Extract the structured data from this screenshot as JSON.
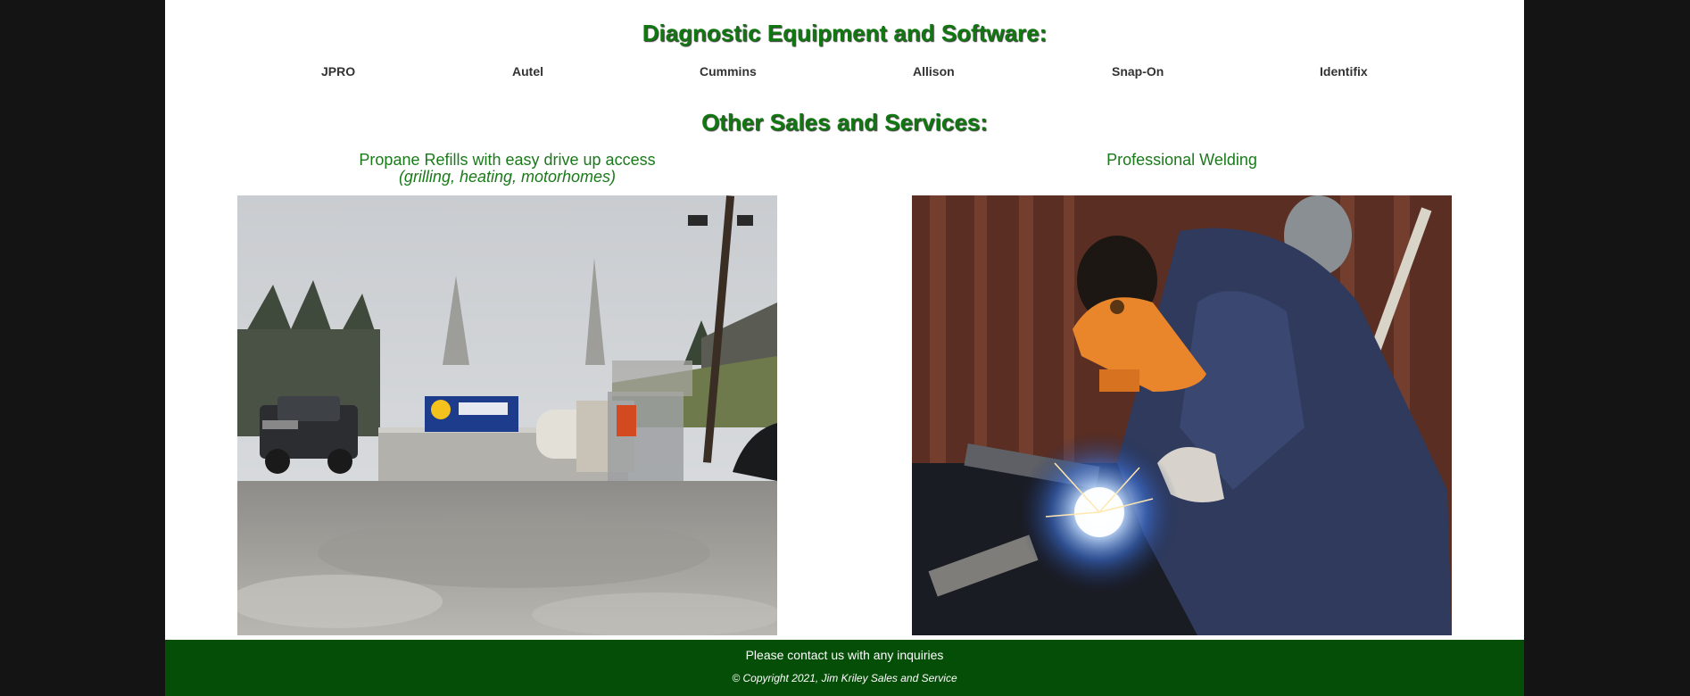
{
  "diagnostic": {
    "title": "Diagnostic Equipment and Software:",
    "brands": [
      "JPRO",
      "Autel",
      "Cummins",
      "Allison",
      "Snap-On",
      "Identifix"
    ]
  },
  "other": {
    "title": "Other Sales and Services:",
    "services": [
      {
        "label": "Propane Refills with easy drive up access",
        "sublabel": "(grilling, heating, motorhomes)",
        "photo": "propane-station-photo"
      },
      {
        "label": "Professional Welding",
        "sublabel": "",
        "photo": "welder-at-work-photo"
      }
    ]
  },
  "footer": {
    "contact": "Please contact us with any inquiries",
    "copyright": "© Copyright 2021, Jim Kriley Sales and Service"
  },
  "colors": {
    "heading_green": "#117711",
    "label_green": "#1a7a1a",
    "footer_green": "#054e07",
    "side_background": "#141414"
  }
}
